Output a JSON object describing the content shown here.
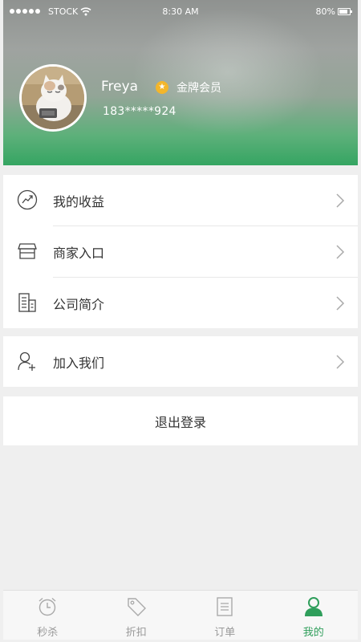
{
  "status_bar": {
    "carrier": "STOCK",
    "time": "8:30 AM",
    "battery": "80%"
  },
  "profile": {
    "name": "Freya",
    "membership": "金牌会员",
    "phone": "183*****924",
    "badge_icon": "star-badge-icon"
  },
  "menu_group_1": [
    {
      "label": "我的收益",
      "icon": "earnings-icon"
    },
    {
      "label": "商家入口",
      "icon": "store-icon"
    },
    {
      "label": "公司简介",
      "icon": "building-icon"
    }
  ],
  "menu_group_2": [
    {
      "label": "加入我们",
      "icon": "add-user-icon"
    }
  ],
  "logout_label": "退出登录",
  "tabs": [
    {
      "label": "秒杀",
      "icon": "alarm-clock-icon"
    },
    {
      "label": "折扣",
      "icon": "tag-icon"
    },
    {
      "label": "订单",
      "icon": "order-list-icon"
    },
    {
      "label": "我的",
      "icon": "user-icon"
    }
  ],
  "active_tab": "我的",
  "colors": {
    "accent_green": "#2f9e5b",
    "gold_badge": "#f3b62b",
    "text_dark": "#333333",
    "tab_inactive": "#999999",
    "background": "#efefef"
  }
}
